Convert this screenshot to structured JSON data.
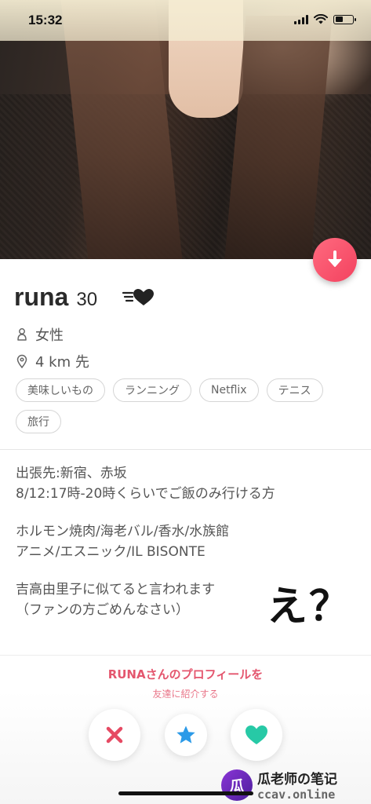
{
  "status_bar": {
    "time": "15:32"
  },
  "profile": {
    "name": "runa",
    "age": "30",
    "gender": "女性",
    "distance": "4 km 先",
    "interests": [
      "美味しいもの",
      "ランニング",
      "Netflix",
      "テニス",
      "旅行"
    ],
    "bio": [
      "出張先:新宿、赤坂",
      "8/12:17時-20時くらいでご飯のみ行ける方",
      "ホルモン焼肉/海老バル/香水/水族館",
      "アニメ/エスニック/IL BISONTE",
      "吉高由里子に似てると言われます",
      "（ファンの方ごめんなさい）"
    ]
  },
  "annotation": "え？",
  "share": {
    "title": "RUNAさんのプロフィールを",
    "subtitle": "友達に紹介する"
  },
  "colors": {
    "brand_pink": "#f3425f",
    "nope": "#e64a63",
    "star": "#2b9ae8",
    "like": "#27c9a6"
  },
  "watermark": {
    "logo_char": "瓜",
    "line1": "瓜老师の笔记",
    "line2": "ccav.online"
  }
}
